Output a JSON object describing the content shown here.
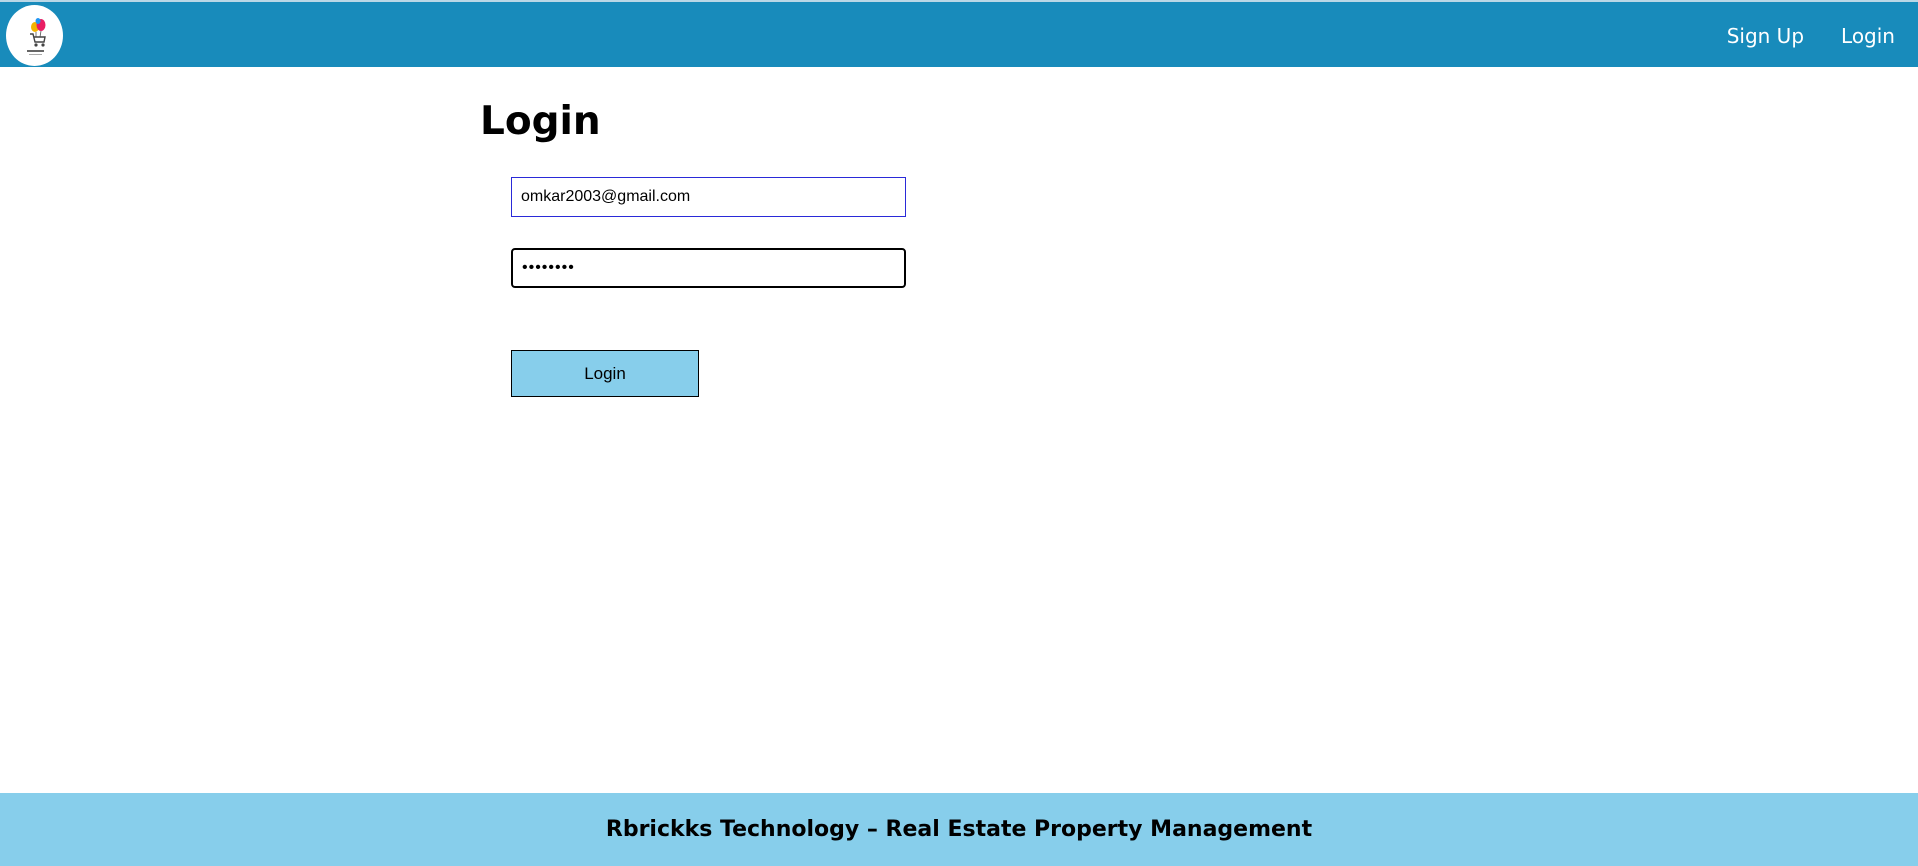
{
  "colors": {
    "navbar": "#188bbb",
    "footer": "#87ceeb",
    "button": "#87ceeb",
    "email_border": "#2a2ad8"
  },
  "header": {
    "logo_icon": "shopping-cart-logo-icon",
    "nav": {
      "signup_label": "Sign Up",
      "login_label": "Login"
    }
  },
  "main": {
    "title": "Login",
    "email_value": "omkar2003@gmail.com",
    "password_value": "••••••••",
    "login_button_label": "Login"
  },
  "footer": {
    "text": "Rbrickks Technology – Real Estate Property Management"
  }
}
